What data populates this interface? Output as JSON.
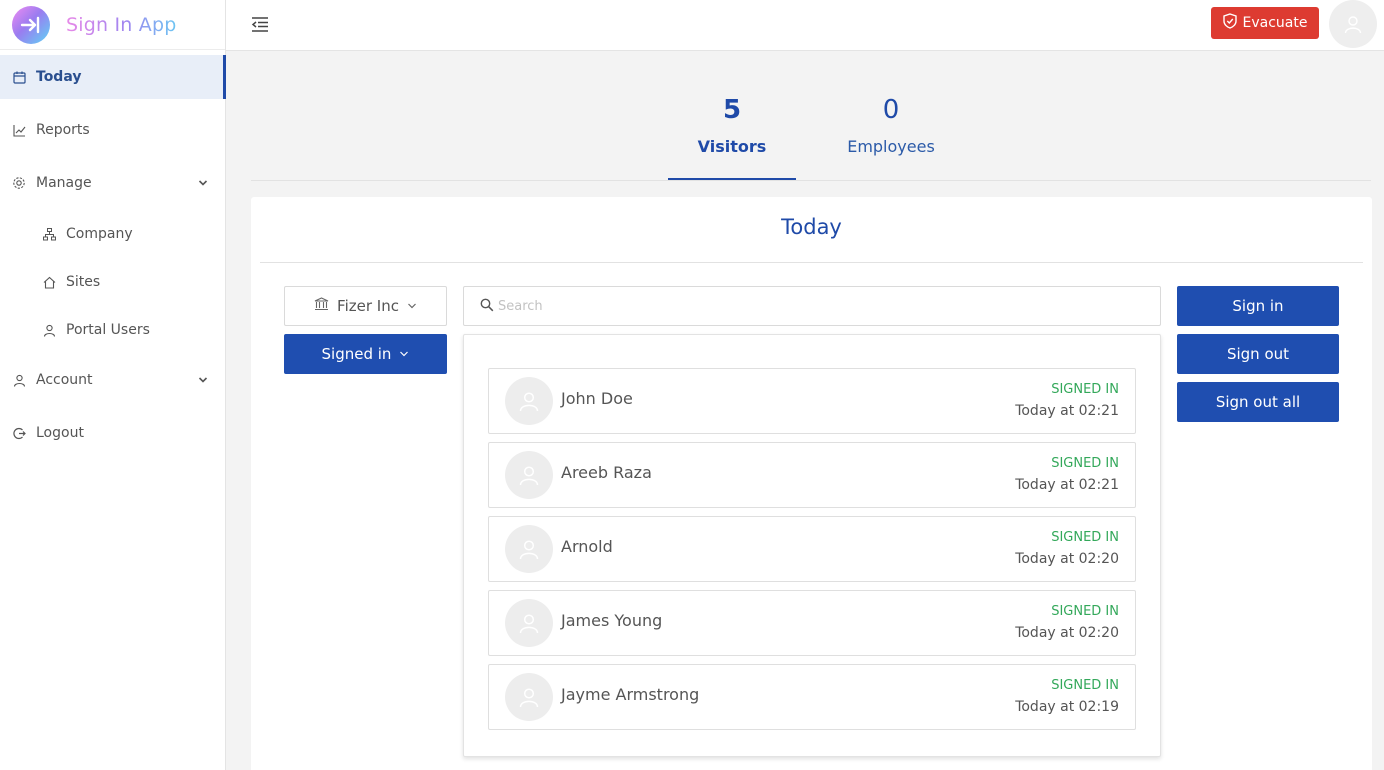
{
  "app": {
    "name": "Sign In App"
  },
  "sidebar": {
    "items": [
      {
        "label": "Today",
        "icon": "calendar-icon"
      },
      {
        "label": "Reports",
        "icon": "line-chart-icon"
      },
      {
        "label": "Manage",
        "icon": "gear-icon"
      },
      {
        "label": "Company",
        "icon": "org-chart-icon"
      },
      {
        "label": "Sites",
        "icon": "home-icon"
      },
      {
        "label": "Portal Users",
        "icon": "user-icon"
      },
      {
        "label": "Account",
        "icon": "user-icon"
      },
      {
        "label": "Logout",
        "icon": "logout-icon"
      }
    ]
  },
  "header": {
    "evacuate_label": "Evacuate"
  },
  "stats": {
    "visitors": {
      "count": "5",
      "label": "Visitors"
    },
    "employees": {
      "count": "0",
      "label": "Employees"
    }
  },
  "main": {
    "title": "Today",
    "company_filter": "Fizer Inc",
    "status_filter": "Signed in",
    "search_placeholder": "Search",
    "visitors": [
      {
        "name": "John Doe",
        "status": "SIGNED IN",
        "time": "Today at 02:21"
      },
      {
        "name": "Areeb Raza",
        "status": "SIGNED IN",
        "time": "Today at 02:21"
      },
      {
        "name": "Arnold",
        "status": "SIGNED IN",
        "time": "Today at 02:20"
      },
      {
        "name": "James Young",
        "status": "SIGNED IN",
        "time": "Today at 02:20"
      },
      {
        "name": "Jayme Armstrong",
        "status": "SIGNED IN",
        "time": "Today at 02:19"
      }
    ]
  },
  "actions": {
    "sign_in": "Sign in",
    "sign_out": "Sign out",
    "sign_out_all": "Sign out all"
  },
  "colors": {
    "primary": "#1f4eb0",
    "danger": "#dd3b31",
    "success": "#33a85a"
  }
}
